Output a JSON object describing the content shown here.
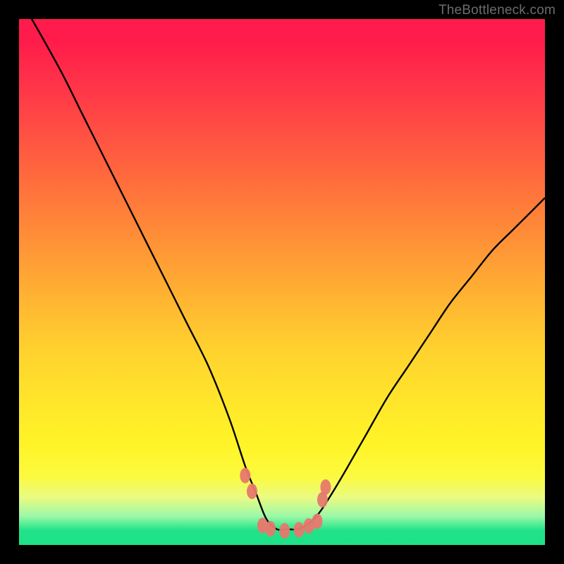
{
  "watermark": "TheBottleneck.com",
  "colors": {
    "frame": "#000000",
    "curve": "#000000",
    "marker": "#e7786e",
    "gradient_top": "#ff1b4b",
    "gradient_bottom": "#1ee188"
  },
  "chart_data": {
    "type": "line",
    "title": "",
    "xlabel": "",
    "ylabel": "",
    "xlim": [
      0,
      100
    ],
    "ylim": [
      0,
      100
    ],
    "note": "Axes unlabeled in original. x = horizontal position (0=left,100=right). y = bottleneck/mismatch percentage (0=bottom/green/best, 100=top/red/worst). Values estimated from pixel positions against gradient bands.",
    "series": [
      {
        "name": "bottleneck-curve",
        "x": [
          0,
          3,
          8,
          12,
          16,
          20,
          24,
          28,
          32,
          36,
          40,
          43,
          45,
          47,
          49,
          51,
          53,
          55,
          57,
          59,
          62,
          66,
          70,
          74,
          78,
          82,
          86,
          90,
          94,
          98,
          100
        ],
        "values": [
          104,
          99,
          90,
          82,
          74,
          66,
          58,
          50,
          42,
          34,
          24,
          15,
          10,
          5,
          3,
          3,
          3,
          4,
          6,
          9,
          14,
          21,
          28,
          34,
          40,
          46,
          51,
          56,
          60,
          64,
          66
        ]
      }
    ],
    "markers": {
      "name": "highlight-points",
      "note": "Salmon dots clustered near the valley floor and its walls.",
      "x": [
        43.0,
        44.3,
        46.3,
        47.8,
        50.5,
        53.2,
        55.1,
        56.7,
        57.7,
        58.3
      ],
      "values": [
        13.2,
        10.2,
        3.7,
        3.1,
        2.7,
        2.9,
        3.6,
        4.5,
        8.6,
        11.0
      ]
    }
  }
}
